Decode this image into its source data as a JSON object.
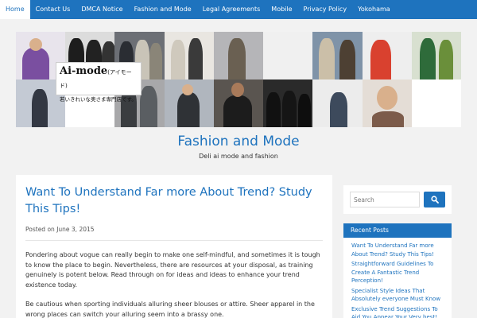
{
  "nav": {
    "items": [
      {
        "label": "Home",
        "active": true
      },
      {
        "label": "Contact Us",
        "active": false
      },
      {
        "label": "DMCA Notice",
        "active": false
      },
      {
        "label": "Fashion and Mode",
        "active": false
      },
      {
        "label": "Legal Agreements",
        "active": false
      },
      {
        "label": "Mobile",
        "active": false
      },
      {
        "label": "Privacy Policy",
        "active": false
      },
      {
        "label": "Yokohama",
        "active": false
      }
    ]
  },
  "banner": {
    "logo_main": "Ai-mode",
    "logo_kana": "(アイモード)",
    "logo_tagline": "若いきれいな奥さま専門店です。"
  },
  "site": {
    "title": "Fashion and Mode",
    "description": "Deli ai mode and fashion"
  },
  "post": {
    "title": "Want To Understand Far more About Trend? Study This Tips!",
    "meta_prefix": "Posted on",
    "date": "June 3, 2015",
    "paragraphs": [
      "Pondering about vogue can really begin to make one self-mindful, and sometimes it is tough to know the place to begin. Nevertheless, there are resources at your disposal, as training genuinely is potent below. Read through on for ideas and ideas to enhance your trend existence today.",
      "Be cautious when sporting individuals alluring sheer blouses or attire. Sheer apparel in the wrong places can switch your alluring seem into a brassy one."
    ]
  },
  "sidebar": {
    "search_placeholder": "Search",
    "recent_title": "Recent Posts",
    "recent_posts": [
      "Want To Understand Far more About Trend? Study This Tips!",
      "Straightforward Guidelines To Create A Fantastic Trend Perception!",
      "Specialist Style Ideas That Absolutely everyone Must Know",
      "Exclusive Trend Suggestions To Aid You Appear Your Very best!"
    ]
  },
  "colors": {
    "accent": "#1e73be",
    "background": "#f2f2f2"
  }
}
